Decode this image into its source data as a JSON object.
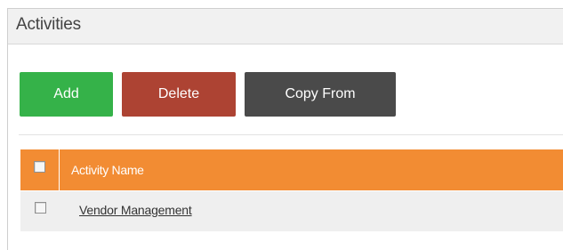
{
  "panel": {
    "title": "Activities"
  },
  "toolbar": {
    "add_label": "Add",
    "delete_label": "Delete",
    "copy_from_label": "Copy From"
  },
  "table": {
    "columns": [
      "",
      "Activity Name"
    ],
    "header_checked": false,
    "rows": [
      {
        "checked": false,
        "name": "Vendor Management"
      }
    ]
  },
  "colors": {
    "add": "#35b249",
    "delete": "#ad4333",
    "copy_from": "#4a4a4a",
    "header": "#f28c33",
    "row": "#efefef"
  },
  "icons": {
    "select_all": "checkbox-icon",
    "row_select": "checkbox-icon"
  }
}
